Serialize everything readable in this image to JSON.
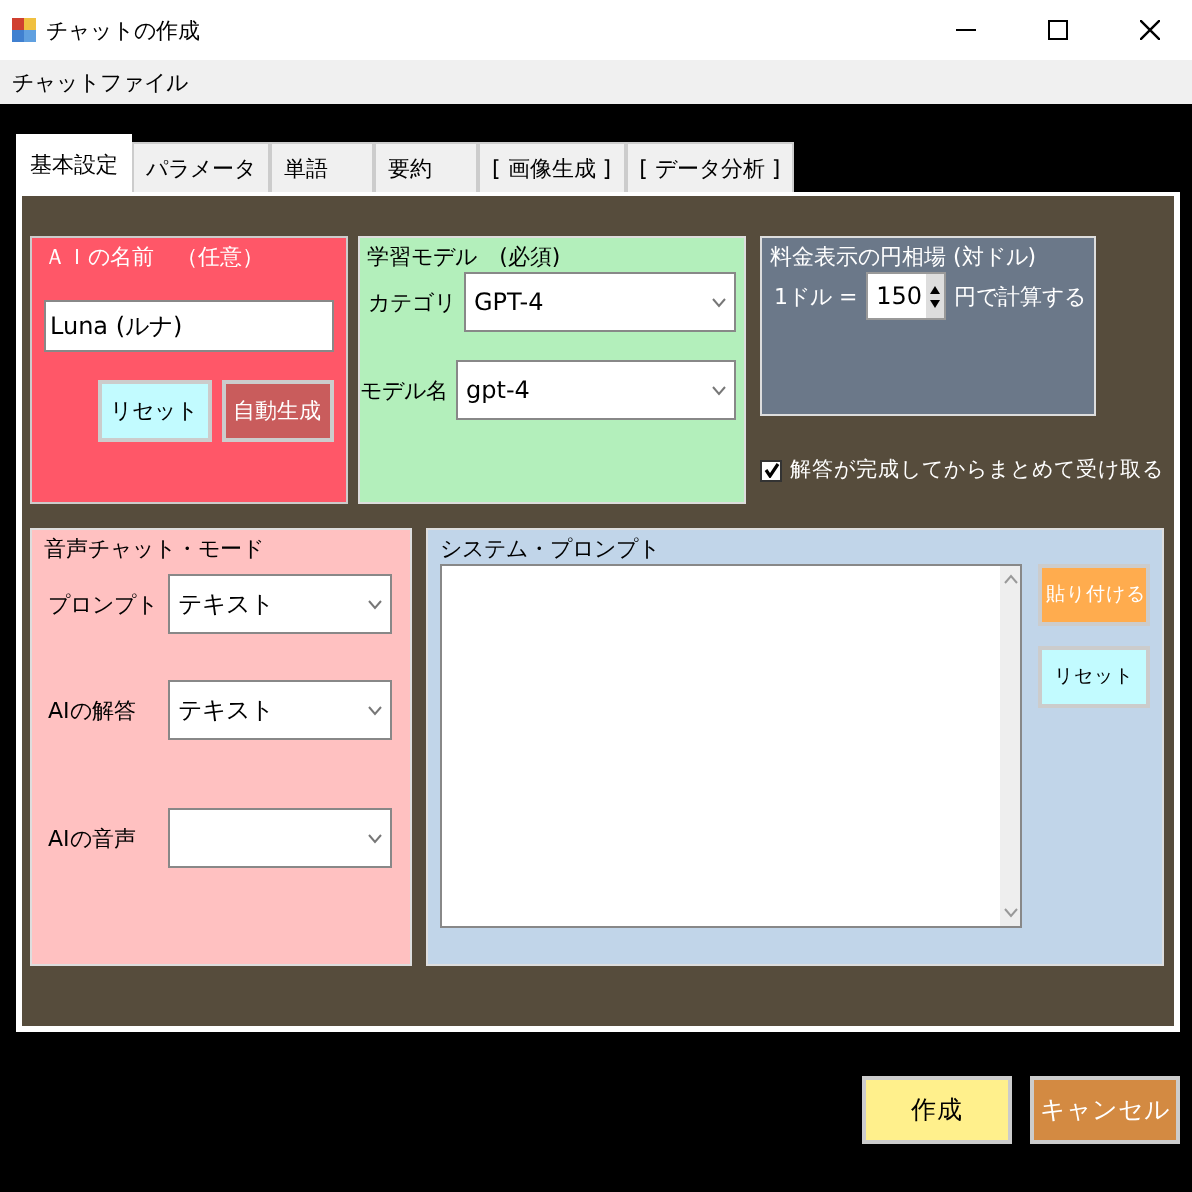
{
  "window": {
    "title": "チャットの作成"
  },
  "menu": [
    "チャットファイル"
  ],
  "tabs": [
    {
      "label": "基本設定",
      "selected": true
    },
    {
      "label": "パラメータ",
      "selected": false
    },
    {
      "label": "単語",
      "selected": false
    },
    {
      "label": "要約",
      "selected": false
    },
    {
      "label": "[ 画像生成 ]",
      "selected": false
    },
    {
      "label": "[ データ分析 ]",
      "selected": false
    }
  ],
  "ai_name": {
    "title": "ＡＩの名前　（任意）",
    "value": "Luna (ルナ)",
    "buttons": [
      "リセット",
      "自動生成"
    ]
  },
  "model": {
    "title": "学習モデル　(必須)",
    "fields": [
      {
        "label": "カテゴリ",
        "value": "GPT-4"
      },
      {
        "label": "モデル名",
        "value": "gpt-4"
      }
    ]
  },
  "rate": {
    "title": "料金表示の円相場 (対ドル)",
    "prefix": "1ドル =",
    "value": "150",
    "suffix": "円で計算する"
  },
  "batch": {
    "label": "解答が完成してからまとめて受け取る",
    "checked": true
  },
  "voice": {
    "title": "音声チャット・モード",
    "fields": [
      {
        "label": "プロンプト",
        "value": "テキスト"
      },
      {
        "label": "AIの解答",
        "value": "テキスト"
      },
      {
        "label": "AIの音声"
      }
    ]
  },
  "system_prompt": {
    "title": "システム・プロンプト",
    "buttons": [
      "貼り付ける",
      "リセット"
    ]
  },
  "buttons": [
    "作成",
    "キャンセル"
  ]
}
